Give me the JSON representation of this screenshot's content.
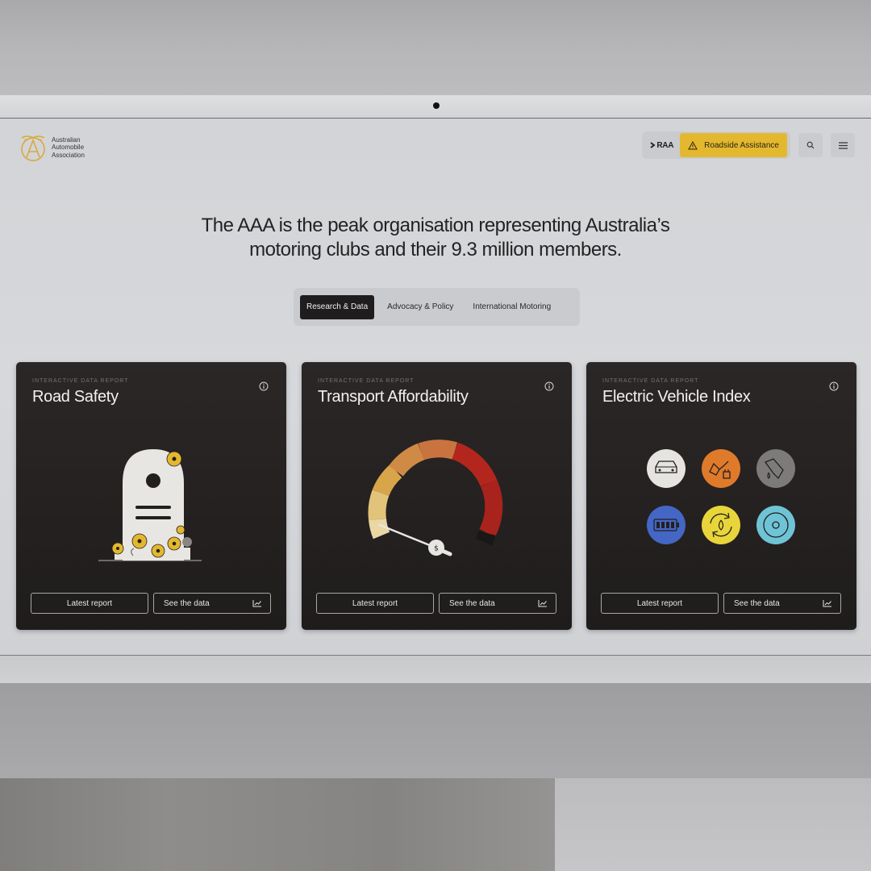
{
  "header": {
    "logo_lines": [
      "Australian",
      "Automobile",
      "Association"
    ],
    "club_label": "RAA",
    "roadside_label": "Roadside Assistance"
  },
  "hero": {
    "line1": "The AAA is the peak organisation representing Australia’s",
    "line2": "motoring clubs and their 9.3 million members."
  },
  "tabs": [
    {
      "label": "Research & Data",
      "active": true
    },
    {
      "label": "Advocacy & Policy",
      "active": false
    },
    {
      "label": "International Motoring",
      "active": false
    }
  ],
  "cards": [
    {
      "eyebrow": "INTERACTIVE DATA REPORT",
      "title": "Road Safety",
      "latest_label": "Latest report",
      "data_label": "See the data"
    },
    {
      "eyebrow": "INTERACTIVE DATA REPORT",
      "title": "Transport Affordability",
      "latest_label": "Latest report",
      "data_label": "See the data"
    },
    {
      "eyebrow": "INTERACTIVE DATA REPORT",
      "title": "Electric Vehicle Index",
      "latest_label": "Latest report",
      "data_label": "See the data"
    }
  ],
  "colors": {
    "accent_yellow": "#e4b82e",
    "card_bg": "#231f1f",
    "gauge_red": "#b3261e",
    "ev_blue": "#4466c4",
    "ev_orange": "#e07a2b",
    "ev_yellow": "#e8d53a",
    "ev_teal": "#6fc3d6"
  },
  "icons": {
    "gauge_center_symbol": "$",
    "ev_icons": [
      "car-icon",
      "plug-icon",
      "fuel-pump-icon",
      "battery-icon",
      "recycle-icon",
      "steering-wheel-icon"
    ]
  }
}
